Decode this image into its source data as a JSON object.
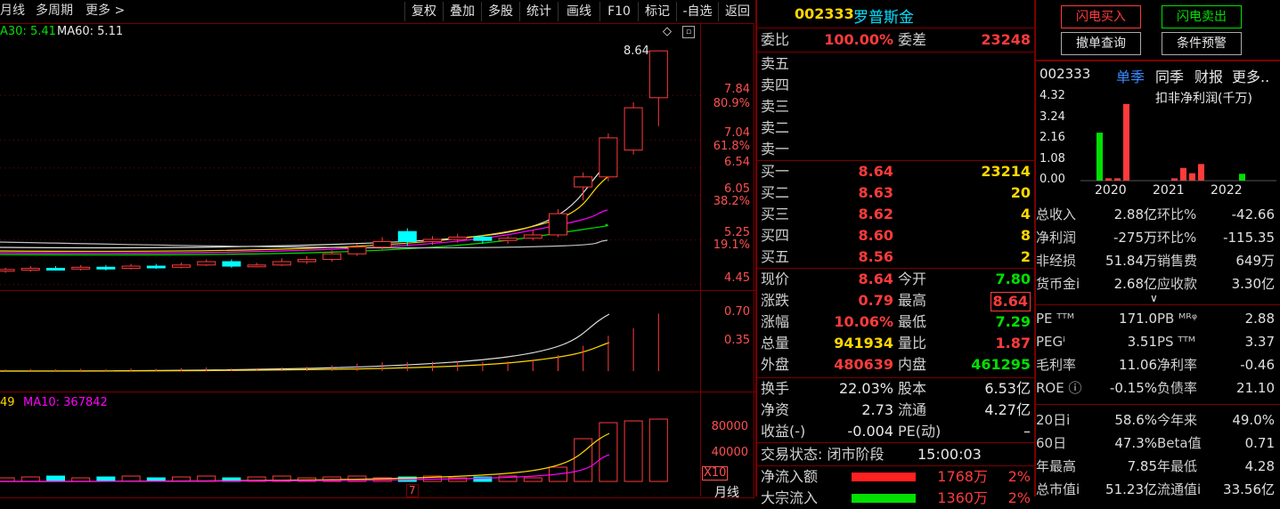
{
  "toolbar": {
    "period": "月线",
    "multi_period": "多周期",
    "more": "更多 >",
    "buttons": [
      "复权",
      "叠加",
      "多股",
      "统计",
      "画线",
      "F10",
      "标记",
      "-自选",
      "返回"
    ]
  },
  "main_chart": {
    "ma_legend": {
      "ma30": "A30: 5.41",
      "ma60": "MA60: 5.11"
    },
    "high_marker": "8.64",
    "axis": [
      "7.84",
      "80.9%",
      "7.04",
      "61.8%",
      "6.54",
      "6.05",
      "38.2%",
      "5.25",
      "19.1%",
      "4.45"
    ]
  },
  "sub_chart1": {
    "axis": [
      "0.70",
      "0.35"
    ]
  },
  "sub_chart2": {
    "legend": {
      "left": "49",
      "ma10": "MA10: 367842"
    },
    "axis": [
      "80000",
      "40000"
    ],
    "unit": "X10",
    "period_label": "月线",
    "x_marker": "7"
  },
  "chart_data": {
    "type": "candlestick",
    "candles": [
      {
        "o": 4.7,
        "c": 4.72,
        "h": 4.75,
        "l": 4.66
      },
      {
        "o": 4.72,
        "c": 4.74,
        "h": 4.78,
        "l": 4.68
      },
      {
        "o": 4.74,
        "c": 4.73,
        "h": 4.78,
        "l": 4.7
      },
      {
        "o": 4.73,
        "c": 4.76,
        "h": 4.8,
        "l": 4.7
      },
      {
        "o": 4.76,
        "c": 4.74,
        "h": 4.8,
        "l": 4.7
      },
      {
        "o": 4.74,
        "c": 4.78,
        "h": 4.82,
        "l": 4.72
      },
      {
        "o": 4.78,
        "c": 4.76,
        "h": 4.82,
        "l": 4.73
      },
      {
        "o": 4.76,
        "c": 4.8,
        "h": 4.84,
        "l": 4.74
      },
      {
        "o": 4.8,
        "c": 4.86,
        "h": 4.9,
        "l": 4.78
      },
      {
        "o": 4.86,
        "c": 4.78,
        "h": 4.9,
        "l": 4.75
      },
      {
        "o": 4.78,
        "c": 4.8,
        "h": 4.84,
        "l": 4.76
      },
      {
        "o": 4.8,
        "c": 4.86,
        "h": 4.92,
        "l": 4.78
      },
      {
        "o": 4.86,
        "c": 4.9,
        "h": 4.96,
        "l": 4.82
      },
      {
        "o": 4.9,
        "c": 5.0,
        "h": 5.06,
        "l": 4.86
      },
      {
        "o": 5.0,
        "c": 5.12,
        "h": 5.18,
        "l": 4.96
      },
      {
        "o": 5.12,
        "c": 5.22,
        "h": 5.3,
        "l": 5.08
      },
      {
        "o": 5.4,
        "c": 5.22,
        "h": 5.46,
        "l": 5.14
      },
      {
        "o": 5.22,
        "c": 5.26,
        "h": 5.32,
        "l": 5.16
      },
      {
        "o": 5.26,
        "c": 5.3,
        "h": 5.36,
        "l": 5.2
      },
      {
        "o": 5.3,
        "c": 5.24,
        "h": 5.34,
        "l": 5.18
      },
      {
        "o": 5.24,
        "c": 5.28,
        "h": 5.32,
        "l": 5.18
      },
      {
        "o": 5.28,
        "c": 5.34,
        "h": 5.42,
        "l": 5.24
      },
      {
        "o": 5.34,
        "c": 5.72,
        "h": 5.8,
        "l": 5.3
      },
      {
        "o": 6.2,
        "c": 6.38,
        "h": 6.46,
        "l": 5.96
      },
      {
        "o": 6.38,
        "c": 7.08,
        "h": 7.16,
        "l": 6.3
      },
      {
        "o": 6.86,
        "c": 7.62,
        "h": 7.72,
        "l": 6.78
      },
      {
        "o": 7.8,
        "c": 8.64,
        "h": 8.64,
        "l": 7.29
      }
    ],
    "ylim": [
      4.35,
      8.85
    ]
  },
  "quote": {
    "code": "002333",
    "name": "罗普斯金",
    "weibi_label": "委比",
    "weibi": "100.00%",
    "weicha_label": "委差",
    "weicha": "23248",
    "sell": [
      {
        "label": "卖五"
      },
      {
        "label": "卖四"
      },
      {
        "label": "卖三"
      },
      {
        "label": "卖二"
      },
      {
        "label": "卖一"
      }
    ],
    "buy": [
      {
        "label": "买一",
        "price": "8.64",
        "vol": "23214"
      },
      {
        "label": "买二",
        "price": "8.63",
        "vol": "20"
      },
      {
        "label": "买三",
        "price": "8.62",
        "vol": "4"
      },
      {
        "label": "买四",
        "price": "8.60",
        "vol": "8"
      },
      {
        "label": "买五",
        "price": "8.56",
        "vol": "2"
      }
    ],
    "stats": [
      {
        "l1": "现价",
        "v1": "8.64",
        "c1": "#ff3b3b",
        "l2": "今开",
        "v2": "7.80",
        "c2": "#00e000"
      },
      {
        "l1": "涨跌",
        "v1": "0.79",
        "c1": "#ff3b3b",
        "l2": "最高",
        "v2": "8.64",
        "c2": "#ff3b3b"
      },
      {
        "l1": "涨幅",
        "v1": "10.06%",
        "c1": "#ff3b3b",
        "l2": "最低",
        "v2": "7.29",
        "c2": "#00e000"
      },
      {
        "l1": "总量",
        "v1": "941934",
        "c1": "#ffd700",
        "l2": "量比",
        "v2": "1.87",
        "c2": "#ff3b3b"
      },
      {
        "l1": "外盘",
        "v1": "480639",
        "c1": "#ff3b3b",
        "l2": "内盘",
        "v2": "461295",
        "c2": "#00e000"
      }
    ],
    "stats2": [
      {
        "l1": "换手",
        "v1": "22.03%",
        "l2": "股本",
        "v2": "6.53亿"
      },
      {
        "l1": "净资",
        "v1": "2.73",
        "l2": "流通",
        "v2": "4.27亿"
      },
      {
        "l1": "收益(-)",
        "v1": "-0.004",
        "l2": "PE(动)",
        "v2": "–"
      }
    ],
    "trade_status_label": "交易状态: 闭市阶段",
    "trade_time": "15:00:03",
    "flow": [
      {
        "label": "净流入额",
        "value": "1768万",
        "pct": "2%"
      },
      {
        "label": "大宗流入",
        "value": "1360万",
        "pct": "2%"
      }
    ]
  },
  "right_panel": {
    "btn_buy": "闪电买入",
    "btn_sell": "闪电卖出",
    "btn_cancel": "撤单查询",
    "btn_alert": "条件预警",
    "code": "002333",
    "tabs": [
      "单季",
      "同季",
      "财报",
      "更多.."
    ],
    "mini_title": "扣非净利润(千万)",
    "mini_axis": [
      "4.32",
      "3.24",
      "2.16",
      "1.08",
      "0.00"
    ],
    "mini_x": [
      "2020",
      "2021",
      "2022"
    ],
    "mini_bars": [
      {
        "value": 2.45,
        "color": "#00e000"
      },
      {
        "value": 0.12,
        "color": "#ff3b3b"
      },
      {
        "value": 0.12,
        "color": "#ff3b3b"
      },
      {
        "value": 3.92,
        "color": "#ff3b3b"
      },
      {
        "value": 0.12,
        "color": "#ff3b3b"
      },
      {
        "value": 0.65,
        "color": "#ff3b3b"
      },
      {
        "value": 0.38,
        "color": "#ff3b3b"
      },
      {
        "value": 0.85,
        "color": "#ff3b3b"
      },
      {
        "value": 0.35,
        "color": "#00e000"
      }
    ],
    "fin1": [
      {
        "l": "总收入",
        "v": "2.88亿",
        "l2": "环比%",
        "v2": "-42.66"
      },
      {
        "l": "净利润",
        "v": "-275万",
        "l2": "环比%",
        "v2": "-115.35"
      },
      {
        "l": "非经损",
        "v": "51.84万",
        "l2": "销售费",
        "v2": "649万"
      },
      {
        "l": "货币金i",
        "v": "2.68亿",
        "l2": "应收款",
        "v2": "3.30亿"
      }
    ],
    "fin2": [
      {
        "l": "PE ᵀᵀᴹ",
        "v": "171.0",
        "l2": "PB ᴹᴿᵠ",
        "v2": "2.88"
      },
      {
        "l": "PEGⁱ",
        "v": "3.51",
        "l2": "PS ᵀᵀᴹ",
        "v2": "3.37"
      },
      {
        "l": "毛利率",
        "v": "11.06",
        "l2": "净利率",
        "v2": "-0.46"
      },
      {
        "l": "ROE ⓘ",
        "v": "-0.15%",
        "l2": "负债率",
        "v2": "21.10"
      }
    ],
    "fin3": [
      {
        "l": "20日i",
        "v": "58.6%",
        "l2": "今年来",
        "v2": "49.0%"
      },
      {
        "l": "60日",
        "v": "47.3%",
        "l2": "Beta值",
        "v2": "0.71"
      },
      {
        "l": "年最高",
        "v": "7.85",
        "l2": "年最低",
        "v2": "4.28"
      },
      {
        "l": "总市值i",
        "v": "51.23亿",
        "l2": "流通值i",
        "v2": "33.56亿"
      }
    ]
  }
}
